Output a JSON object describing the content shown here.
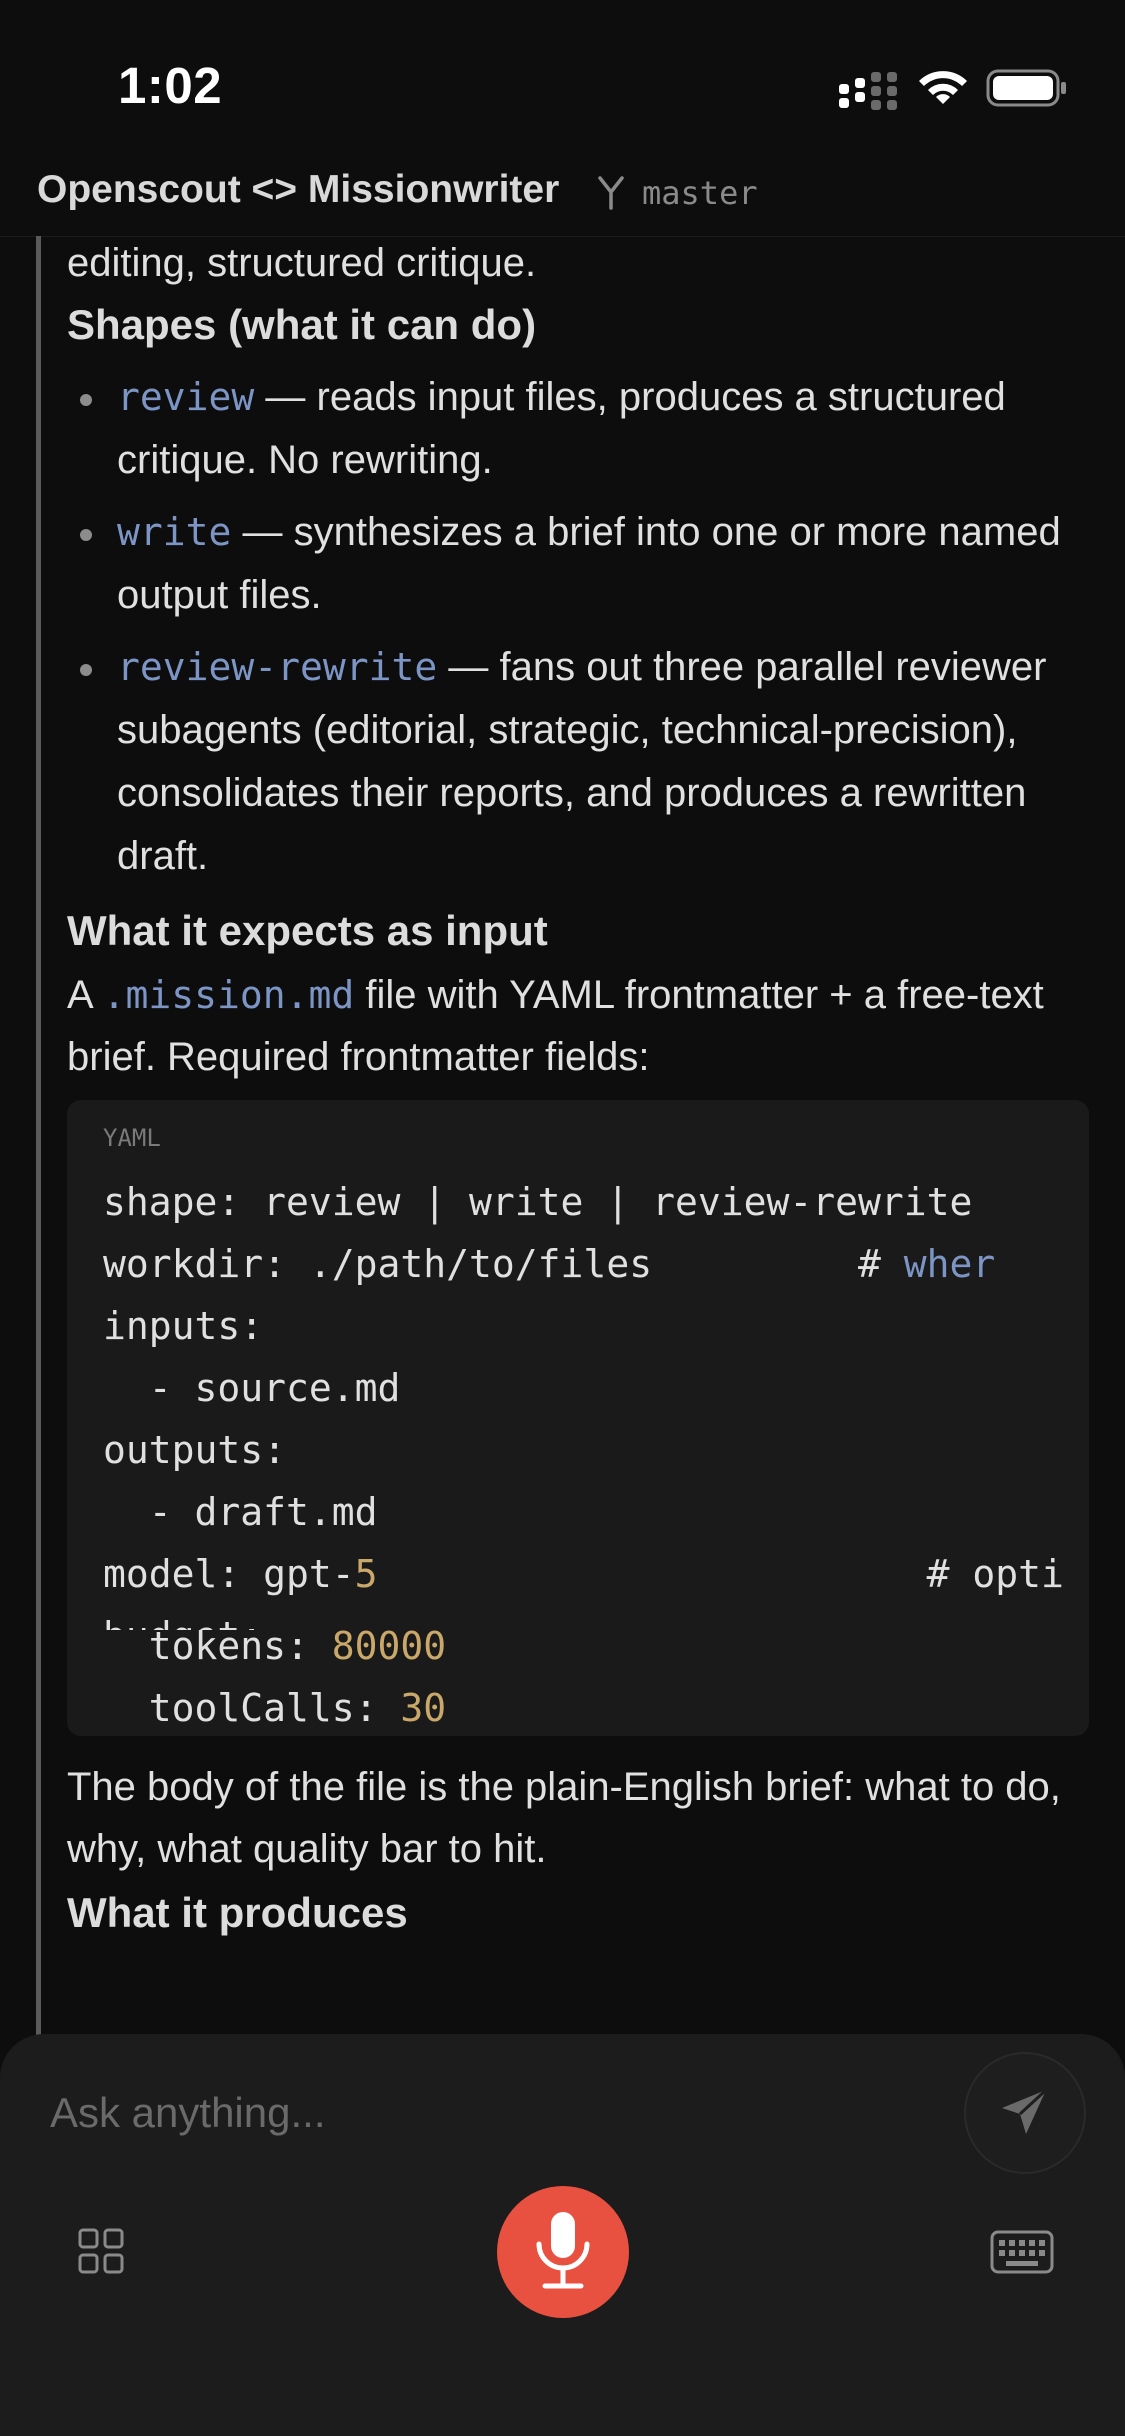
{
  "status": {
    "time": "1:02"
  },
  "header": {
    "title": "Openscout <> Missionwriter",
    "branch": "master"
  },
  "content": {
    "intro_tail": "editing, structured critique.",
    "shapes_heading": "Shapes (what it can do)",
    "shapes": [
      {
        "code": "review",
        "text": " — reads input files, produces a structured critique. No rewriting."
      },
      {
        "code": "write",
        "text": " — synthesizes a brief into one or more named output files."
      },
      {
        "code": "review-rewrite",
        "text": " — fans out three parallel reviewer subagents (editorial, strategic, technical-precision), consolidates their reports, and produces a rewritten draft."
      }
    ],
    "input_heading": "What it expects as input",
    "input_pre": "A ",
    "input_code": ".mission.md",
    "input_post": " file with YAML frontmatter + a free-text brief. Required frontmatter fields:",
    "code_lang": "YAML",
    "code_lines": {
      "l1": "shape: review | write | review-rewrite",
      "l2a": "workdir: ./path/to/files         # ",
      "l2b": "wher",
      "l3": "inputs:",
      "l4": "  - source.md",
      "l5": "outputs:",
      "l6": "  - draft.md",
      "l7a": "model: gpt-",
      "l7b": "5",
      "l7c": "                        # opti",
      "l8": "budget:",
      "l9a": "  tokens: ",
      "l9b": "80000",
      "l10a": "  toolCalls: ",
      "l10b": "30"
    },
    "body_text": "The body of the file is the plain-English brief: what to do, why, what quality bar to hit.",
    "produces_heading": "What it produces"
  },
  "composer": {
    "placeholder": "Ask anything..."
  },
  "colors": {
    "accent_mic": "#e8513f",
    "code_inline": "#7c95c5",
    "code_number": "#c9a86a"
  },
  "icons": [
    "branch-icon",
    "send-icon",
    "grid-icon",
    "mic-icon",
    "keyboard-icon",
    "wifi-icon",
    "battery-icon",
    "signal-icon"
  ]
}
